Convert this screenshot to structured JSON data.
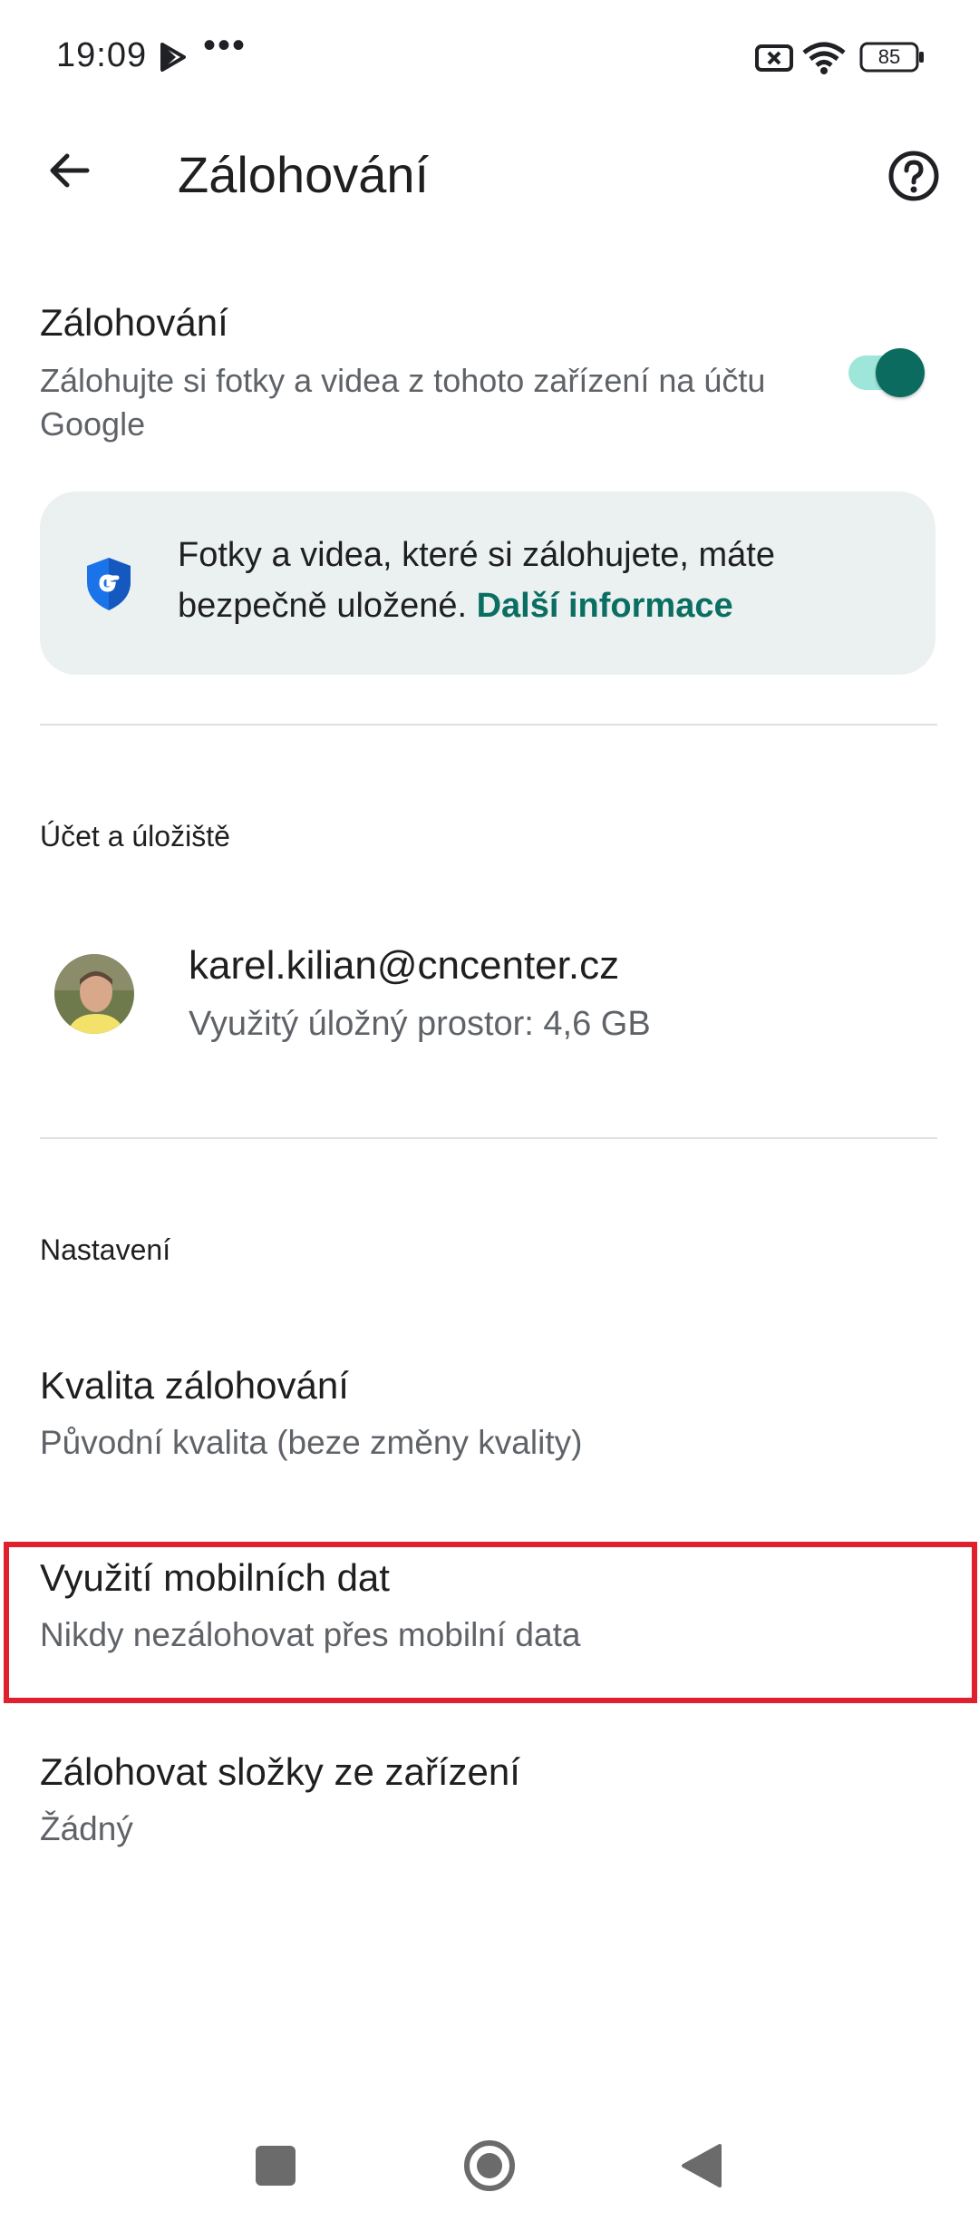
{
  "status_bar": {
    "time": "19:09",
    "dots": "•••",
    "battery": "85"
  },
  "app_bar": {
    "title": "Zálohování"
  },
  "backup": {
    "title": "Zálohování",
    "subtitle": "Zálohujte si fotky a videa z tohoto zařízení na účtu Google",
    "enabled": true
  },
  "info_card": {
    "text": "Fotky a videa, které si zálohujete, máte bezpečně uložené.",
    "link": "Další informace"
  },
  "account_section": {
    "header": "Účet a úložiště",
    "email": "karel.kilian@cncenter.cz",
    "storage": "Využitý úložný prostor: 4,6 GB"
  },
  "settings_section": {
    "header": "Nastavení",
    "items": [
      {
        "title": "Kvalita zálohování",
        "subtitle": "Původní kvalita (beze změny kvality)"
      },
      {
        "title": "Využití mobilních dat",
        "subtitle": "Nikdy nezálohovat přes mobilní data",
        "highlighted": true
      },
      {
        "title": "Zálohovat složky ze zařízení",
        "subtitle": "Žádný"
      }
    ]
  },
  "colors": {
    "accent": "#0b6b5e",
    "link": "#0b6e62",
    "highlight": "#e0202c",
    "card": "#eaf1f0"
  }
}
